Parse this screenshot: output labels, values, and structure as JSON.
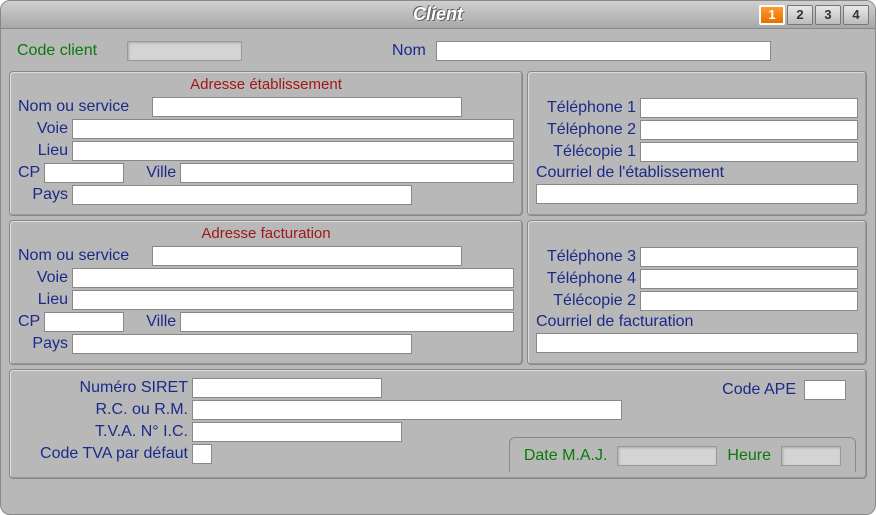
{
  "window": {
    "title": "Client"
  },
  "tabs": [
    "1",
    "2",
    "3",
    "4"
  ],
  "top": {
    "code_client_label": "Code client",
    "code_client_value": "",
    "nom_label": "Nom",
    "nom_value": ""
  },
  "etab": {
    "header": "Adresse établissement",
    "nom_service_label": "Nom ou service",
    "nom_service_value": "",
    "voie_label": "Voie",
    "voie_value": "",
    "lieu_label": "Lieu",
    "lieu_value": "",
    "cp_label": "CP",
    "cp_value": "",
    "ville_label": "Ville",
    "ville_value": "",
    "pays_label": "Pays",
    "pays_value": ""
  },
  "etab_contact": {
    "tel1_label": "Téléphone 1",
    "tel1_value": "",
    "tel2_label": "Téléphone 2",
    "tel2_value": "",
    "fax1_label": "Télécopie 1",
    "fax1_value": "",
    "email_label": "Courriel de l'établissement",
    "email_value": ""
  },
  "fact": {
    "header": "Adresse facturation",
    "nom_service_label": "Nom ou service",
    "nom_service_value": "",
    "voie_label": "Voie",
    "voie_value": "",
    "lieu_label": "Lieu",
    "lieu_value": "",
    "cp_label": "CP",
    "cp_value": "",
    "ville_label": "Ville",
    "ville_value": "",
    "pays_label": "Pays",
    "pays_value": ""
  },
  "fact_contact": {
    "tel3_label": "Téléphone 3",
    "tel3_value": "",
    "tel4_label": "Téléphone 4",
    "tel4_value": "",
    "fax2_label": "Télécopie 2",
    "fax2_value": "",
    "email_label": "Courriel de facturation",
    "email_value": ""
  },
  "bottom": {
    "siret_label": "Numéro SIRET",
    "siret_value": "",
    "rc_label": "R.C. ou R.M.",
    "rc_value": "",
    "tva_ic_label": "T.V.A. N° I.C.",
    "tva_ic_value": "",
    "code_tva_label": "Code TVA par défaut",
    "code_tva_value": "",
    "code_ape_label": "Code APE",
    "code_ape_value": "",
    "date_maj_label": "Date M.A.J.",
    "date_maj_value": "",
    "heure_label": "Heure",
    "heure_value": ""
  }
}
